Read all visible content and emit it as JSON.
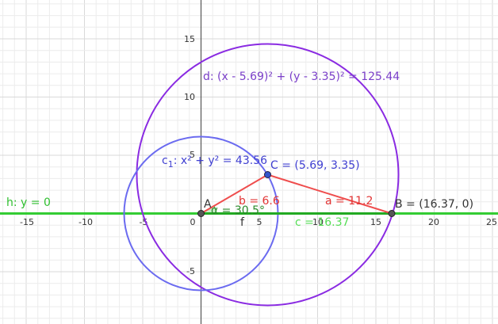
{
  "colors": {
    "line_h": "#33cc33",
    "circle_c1": "#6b6bf0",
    "circle_d": "#8a2be2",
    "triangle": "#ef4d4d",
    "angle_fill": "#66cc66",
    "point_fill": "#555555",
    "point_c_fill": "#3355cc",
    "label_purple": "#7a3fc9",
    "label_blue": "#3f3fd1",
    "label_red": "#e23535",
    "label_green": "#2fbf2f",
    "label_dark": "#333333",
    "label_c_len": "#55dd55"
  },
  "axes": {
    "x_ticks": [
      "-15",
      "-10",
      "-5",
      "0",
      "5",
      "10",
      "15",
      "20",
      "25"
    ],
    "y_ticks": [
      "15",
      "10",
      "5",
      "-5"
    ]
  },
  "labels": {
    "line_h": "h: y = 0",
    "circle_d": "d: (x - 5.69)² + (y - 3.35)² = 125.44",
    "circle_c1_prefix": "c",
    "circle_c1_sub": "1",
    "circle_c1_rest": ": x² + y² = 43.56",
    "point_a": "A",
    "point_b": "B = (16.37, 0)",
    "point_c": "C = (5.69, 3.35)",
    "seg_b": "b = 6.6",
    "seg_a": "a = 11.2",
    "seg_c": "c = 16.37",
    "angle_alpha": "α = 30.5°",
    "seg_f": "f"
  }
}
